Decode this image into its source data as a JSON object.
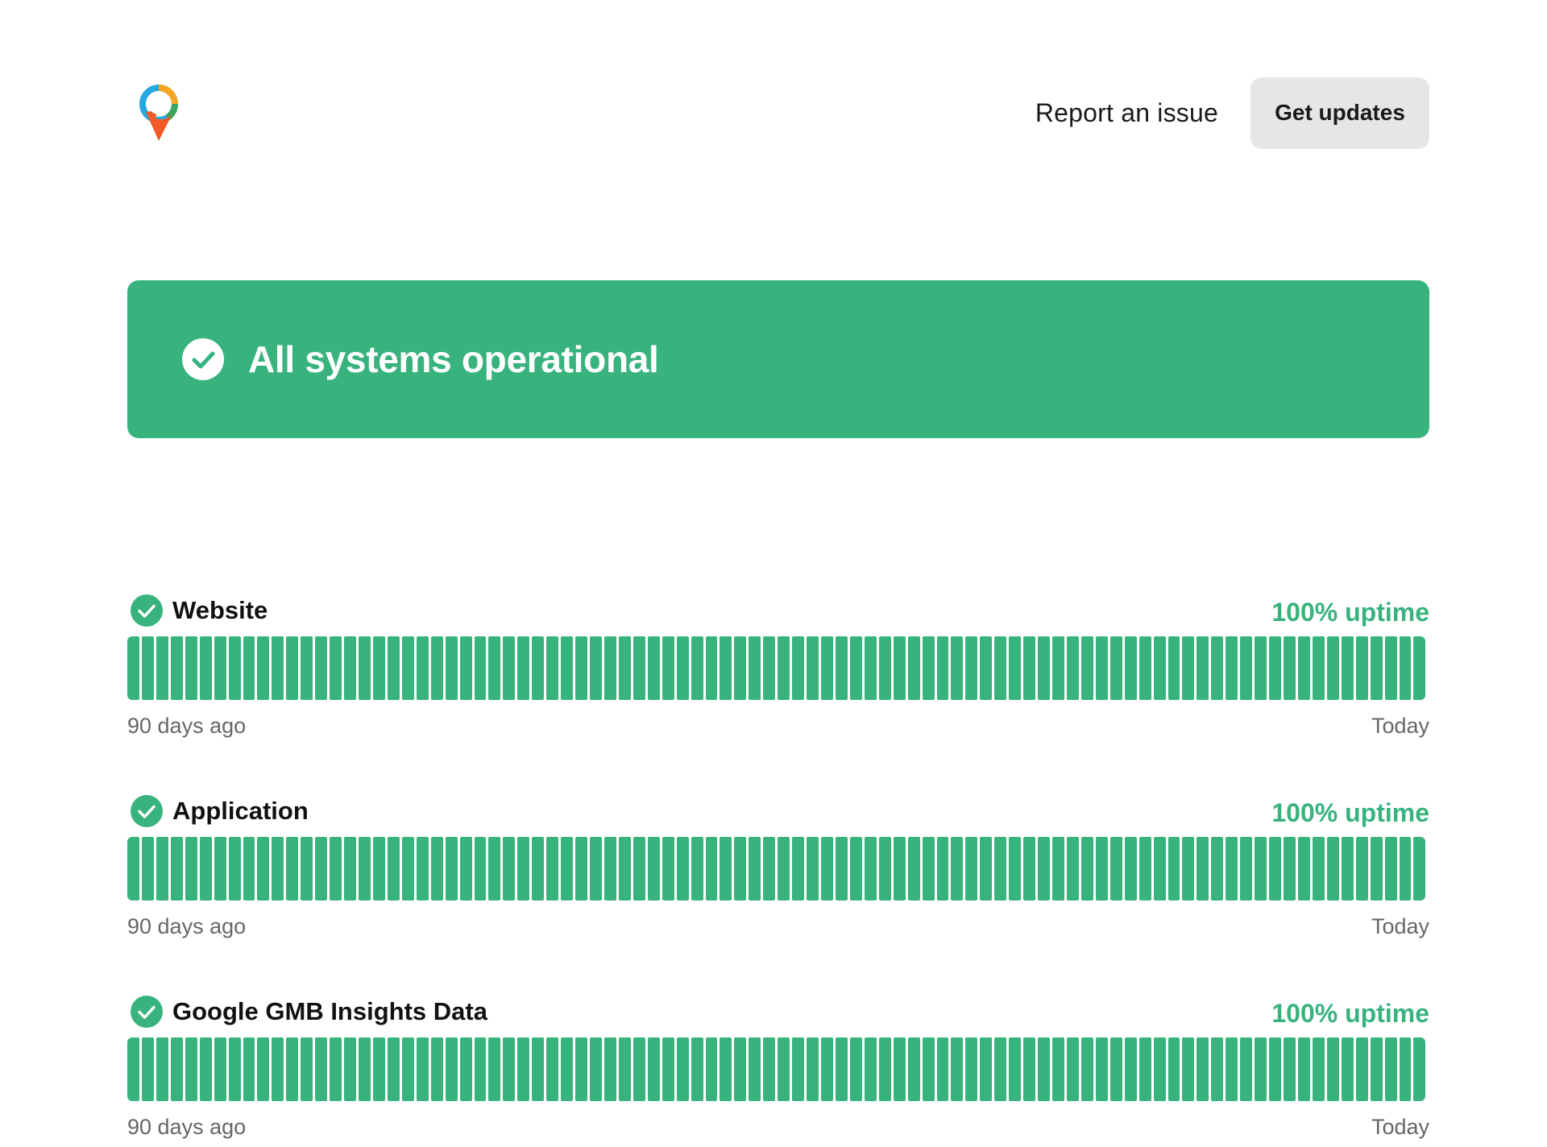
{
  "header": {
    "report_label": "Report an issue",
    "updates_label": "Get updates"
  },
  "status": {
    "message": "All systems operational",
    "color": "#38b37e"
  },
  "components": [
    {
      "name": "Website",
      "uptime": "100% uptime",
      "uptime_fraction": 1.0,
      "days": 90,
      "range_start": "90 days ago",
      "range_end": "Today"
    },
    {
      "name": "Application",
      "uptime": "100% uptime",
      "uptime_fraction": 1.0,
      "days": 90,
      "range_start": "90 days ago",
      "range_end": "Today"
    },
    {
      "name": "Google GMB Insights Data",
      "uptime": "100% uptime",
      "uptime_fraction": 1.0,
      "days": 90,
      "range_start": "90 days ago",
      "range_end": "Today"
    }
  ],
  "colors": {
    "operational": "#38b37e",
    "button_bg": "#e6e6e6",
    "muted_text": "#666666"
  },
  "icons": {
    "logo": "location-pin-logo-icon",
    "status": "check-circle-icon"
  }
}
